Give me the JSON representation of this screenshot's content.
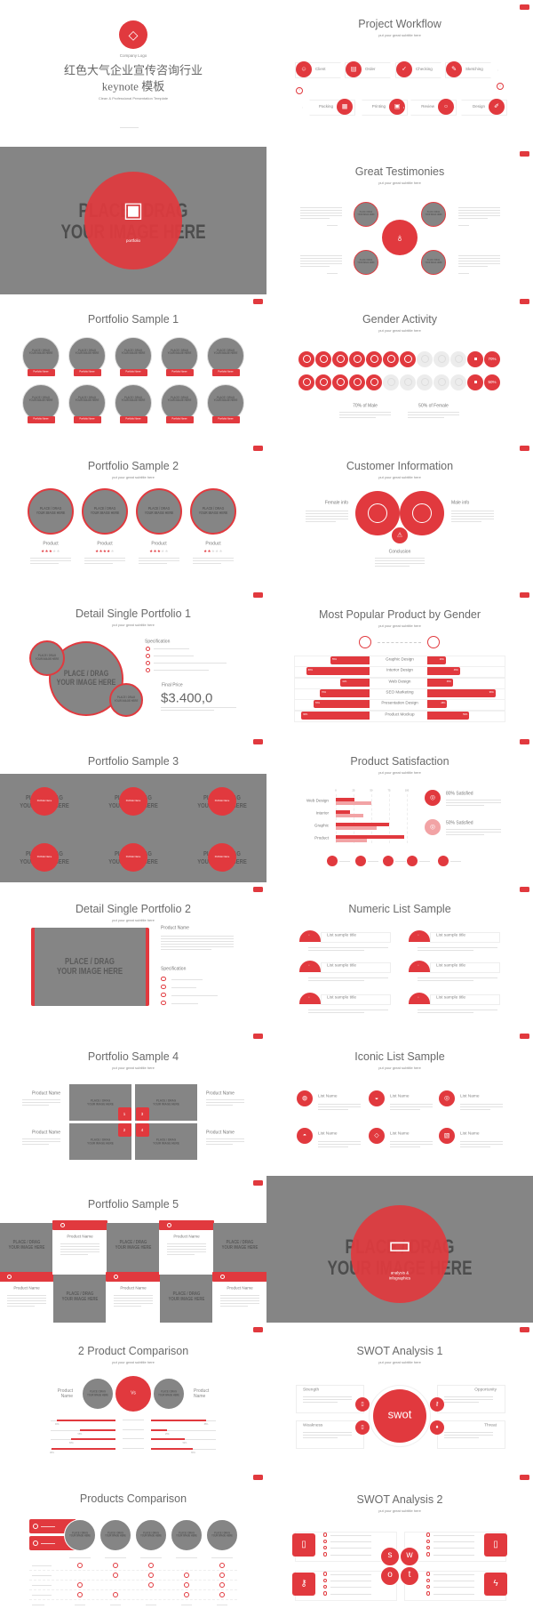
{
  "theme": {
    "accent": "#e1393e",
    "accent_light": "#f2a3a5",
    "placeholder": "#858585",
    "title_text": "#6a6a6a"
  },
  "placeholder_text": [
    "PLACE / DRAG",
    "YOUR IMAGE HERE"
  ],
  "subtitle": "put your great subtitle here",
  "slides": {
    "cover": {
      "logo_icon": "diamond-icon",
      "company_logo": "Company Logo",
      "title_cn": "红色大气企业宣传咨询行业",
      "title_line2": "keynote 模板",
      "tagline": "Clean & Professional Presentation Template"
    },
    "workflow": {
      "title": "Project Workflow",
      "steps_top": [
        {
          "label": "Client",
          "icon": "user-icon"
        },
        {
          "label": "Order",
          "icon": "document-icon"
        },
        {
          "label": "Checking",
          "icon": "check-icon"
        },
        {
          "label": "Sketching",
          "icon": "edit-icon"
        }
      ],
      "steps_bottom": [
        {
          "label": "Packing",
          "icon": "package-icon"
        },
        {
          "label": "Printing",
          "icon": "print-icon"
        },
        {
          "label": "Review",
          "icon": "search-icon"
        },
        {
          "label": "Design",
          "icon": "pencil-icon"
        }
      ]
    },
    "portfolio_section": {
      "label": "portfolio",
      "icon": "box-icon"
    },
    "testimonies": {
      "title": "Great Testimonies",
      "icon": "microphone-icon"
    },
    "portfolio1": {
      "title": "Portfolio Sample 1",
      "item_label": "Portfolio Name"
    },
    "gender": {
      "title": "Gender Activity",
      "male_percent": 70,
      "female_percent": 50,
      "male_value": "70%",
      "female_value": "50%",
      "male_caption": "70% of Male",
      "female_caption": "50% of Female"
    },
    "portfolio2": {
      "title": "Portfolio Sample 2",
      "items": [
        {
          "name": "Product",
          "stars": 3
        },
        {
          "name": "Product",
          "stars": 4
        },
        {
          "name": "Product",
          "stars": 3
        },
        {
          "name": "Product",
          "stars": 2
        }
      ]
    },
    "customer": {
      "title": "Customer Information",
      "female": "Female info",
      "male": "Male info",
      "conclusion": "Conclusion"
    },
    "detail1": {
      "title": "Detail Single Portfolio 1",
      "spec": "Specification",
      "price_label": "Final Price",
      "price": "$3.400,0"
    },
    "popular": {
      "title": "Most Popular Product by Gender",
      "categories": [
        "Graphic Design",
        "Interior Design",
        "Web Design",
        "SEO Marketing",
        "Presentation Design",
        "Product Mockup"
      ],
      "left_values": [
        55,
        89,
        41,
        70,
        79,
        96
      ],
      "right_values": [
        26,
        46,
        36,
        96,
        28,
        59
      ]
    },
    "portfolio3": {
      "title": "Portfolio Sample 3",
      "item_label": "Portfolio Name"
    },
    "satisfaction": {
      "title": "Product Satisfaction",
      "chart_ticks": [
        "0",
        "25",
        "50",
        "75",
        "100"
      ],
      "categories": [
        "Web Design",
        "Interior",
        "Graphic",
        "Product"
      ],
      "dark_values": [
        26,
        20,
        75,
        96
      ],
      "light_values": [
        50,
        39,
        57,
        44
      ],
      "stat1": "80% Satisfied",
      "stat2": "50% Satisfied"
    },
    "detail2": {
      "title": "Detail Single Portfolio 2",
      "product_name": "Product Name",
      "spec": "Specification"
    },
    "numeric": {
      "title": "Numeric List Sample",
      "item_title": "List sample title"
    },
    "portfolio4": {
      "title": "Portfolio Sample 4",
      "product_name": "Product Name",
      "numbers": [
        "1",
        "3",
        "2",
        "4"
      ]
    },
    "iconic": {
      "title": "Iconic List Sample",
      "item_title": "List Name",
      "icons": [
        "bag-icon",
        "cup-icon",
        "compass-icon",
        "cake-icon",
        "diamond-icon",
        "chart-icon"
      ]
    },
    "portfolio5": {
      "title": "Portfolio Sample 5",
      "product_name": "Product Name"
    },
    "analysis_section": {
      "label": "analysis & infographics",
      "icon": "presentation-board-icon"
    },
    "comparison2": {
      "title": "2 Product Comparison",
      "product_name": "Product Name",
      "vs": "Vs",
      "left_values": [
        90,
        55,
        68,
        98
      ],
      "right_values": [
        85,
        25,
        52,
        65
      ]
    },
    "swot1": {
      "title": "SWOT Analysis 1",
      "center": "swot",
      "strength": "Strength",
      "weakness": "Weakness",
      "opportunity": "Opportunity",
      "threat": "Threat"
    },
    "comparison": {
      "title": "Products Comparison",
      "checks": [
        [
          1,
          1,
          1,
          0,
          1
        ],
        [
          0,
          1,
          1,
          1,
          1
        ],
        [
          1,
          0,
          1,
          1,
          1
        ],
        [
          1,
          1,
          0,
          1,
          1
        ]
      ]
    },
    "swot2": {
      "title": "SWOT Analysis 2",
      "letters": [
        "s",
        "w",
        "o",
        "t"
      ]
    }
  }
}
